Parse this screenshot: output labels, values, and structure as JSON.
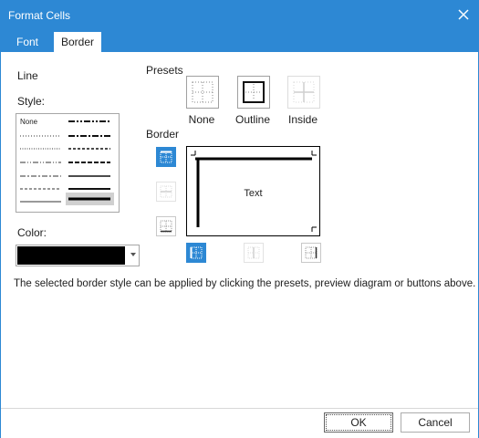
{
  "window": {
    "title": "Format Cells"
  },
  "tabs": [
    {
      "label": "Font"
    },
    {
      "label": "Border",
      "selected": true
    }
  ],
  "line": {
    "section_label": "Line",
    "style_label": "Style:",
    "styles": [
      "None",
      "dotted",
      "dash-dot",
      "dash-dot-dot",
      "dashed",
      "dash-dot-medium",
      "medium",
      "medium-dash-dot",
      "medium-dash-dot-dot",
      "medium-dashed",
      "thin",
      "thick"
    ],
    "selected_style": "thick",
    "none_label": "None",
    "color_label": "Color:",
    "color_value": "#000000"
  },
  "presets": {
    "label": "Presets",
    "items": [
      {
        "label": "None",
        "enabled": true
      },
      {
        "label": "Outline",
        "enabled": true
      },
      {
        "label": "Inside",
        "enabled": false
      }
    ]
  },
  "border": {
    "label": "Border",
    "preview_text": "Text",
    "buttons": [
      {
        "id": "top",
        "active": true
      },
      {
        "id": "middle-horizontal",
        "active": false,
        "enabled": false
      },
      {
        "id": "bottom",
        "active": false
      },
      {
        "id": "left",
        "active": true
      },
      {
        "id": "middle-vertical",
        "active": false,
        "enabled": false
      },
      {
        "id": "right",
        "active": false
      }
    ]
  },
  "hint": "The selected border style can be applied by clicking the presets, preview diagram or buttons above.",
  "buttons": {
    "ok": "OK",
    "cancel": "Cancel"
  },
  "colors": {
    "accent": "#2d88d4",
    "title_text": "#ffffff"
  }
}
